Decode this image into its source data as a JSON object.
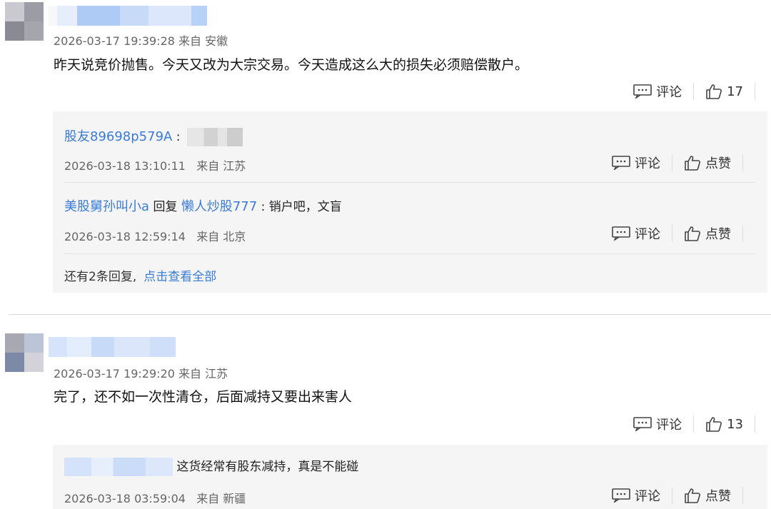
{
  "comments": [
    {
      "time": "2026-03-17 19:39:28",
      "location": "来自 安徽",
      "text": "昨天说竞价抛售。今天又改为大宗交易。今天造成这么大的损失必须赔偿散户。",
      "reply_label": "评论",
      "likes": "17",
      "replies": [
        {
          "user": "股友89698p579A",
          "colon": ":",
          "time": "2026-03-18 13:10:11",
          "location": "来自 江苏",
          "reply_label": "评论",
          "like_label": "点赞"
        },
        {
          "user": "美股舅孙叫小a",
          "reply_word": "回复",
          "target_user": "懒人炒股777",
          "text": ": 销户吧，文盲",
          "time": "2026-03-18 12:59:14",
          "location": "来自 北京",
          "reply_label": "评论",
          "like_label": "点赞"
        }
      ],
      "more_text": "还有2条回复,",
      "more_link": "点击查看全部"
    },
    {
      "time": "2026-03-17 19:29:20",
      "location": "来自 江苏",
      "text": "完了，还不如一次性清仓，后面减持又要出来害人",
      "reply_label": "评论",
      "likes": "13",
      "replies": [
        {
          "text": "这货经常有股东减持，真是不能碰",
          "time": "2026-03-18 03:59:04",
          "location": "来自 新疆",
          "reply_label": "评论",
          "like_label": "点赞"
        }
      ]
    }
  ]
}
